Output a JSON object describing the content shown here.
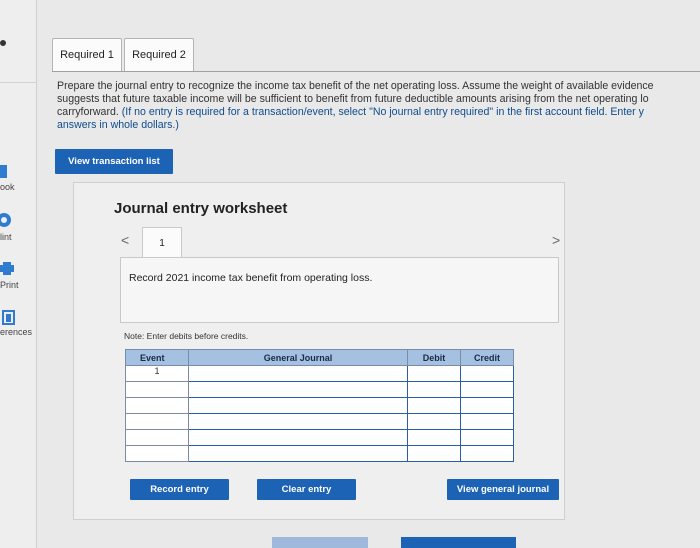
{
  "sidebar": {
    "items": [
      {
        "label": "ook",
        "icon": "book-icon"
      },
      {
        "label": "lint",
        "icon": "hint-icon"
      },
      {
        "label": "Print",
        "icon": "print-icon"
      },
      {
        "label": "erences",
        "icon": "references-icon"
      }
    ]
  },
  "tabs": [
    {
      "label": "Required 1",
      "active": true
    },
    {
      "label": "Required 2",
      "active": false
    }
  ],
  "instructions": {
    "main": "Prepare the journal entry to recognize the income tax benefit of the net operating loss. Assume the weight of available evidence suggests that future taxable income will be sufficient to benefit from future deductible amounts arising from the net operating loss carryforward.",
    "line1": "Prepare the journal entry to recognize the income tax benefit of the net operating loss. Assume the weight of available evidence",
    "line2": "suggests that future taxable income will be sufficient to benefit from future deductible amounts arising from the net operating lo",
    "line3a": "carryforward. ",
    "line3b": "(If no entry is required for a transaction/event, select \"No journal entry required\" in the first account field. Enter y",
    "line4": "answers in whole dollars.)"
  },
  "view_transaction_list": "View transaction list",
  "worksheet": {
    "title": "Journal entry worksheet",
    "prev_arrow": "<",
    "next_arrow": ">",
    "tab_number": "1",
    "record_text": "Record 2021 income tax benefit from operating loss.",
    "note": "Note: Enter debits before credits.",
    "columns": [
      "Event",
      "General Journal",
      "Debit",
      "Credit"
    ],
    "rows": [
      {
        "event": "1",
        "account": "",
        "debit": "",
        "credit": ""
      },
      {
        "event": "",
        "account": "",
        "debit": "",
        "credit": ""
      },
      {
        "event": "",
        "account": "",
        "debit": "",
        "credit": ""
      },
      {
        "event": "",
        "account": "",
        "debit": "",
        "credit": ""
      },
      {
        "event": "",
        "account": "",
        "debit": "",
        "credit": ""
      },
      {
        "event": "",
        "account": "",
        "debit": "",
        "credit": ""
      }
    ],
    "record_entry": "Record entry",
    "clear_entry": "Clear entry",
    "view_general_journal": "View general journal"
  },
  "colors": {
    "accent": "#1d63b5",
    "table_header": "#a5c1e2",
    "input_border": "#2b5da6"
  }
}
